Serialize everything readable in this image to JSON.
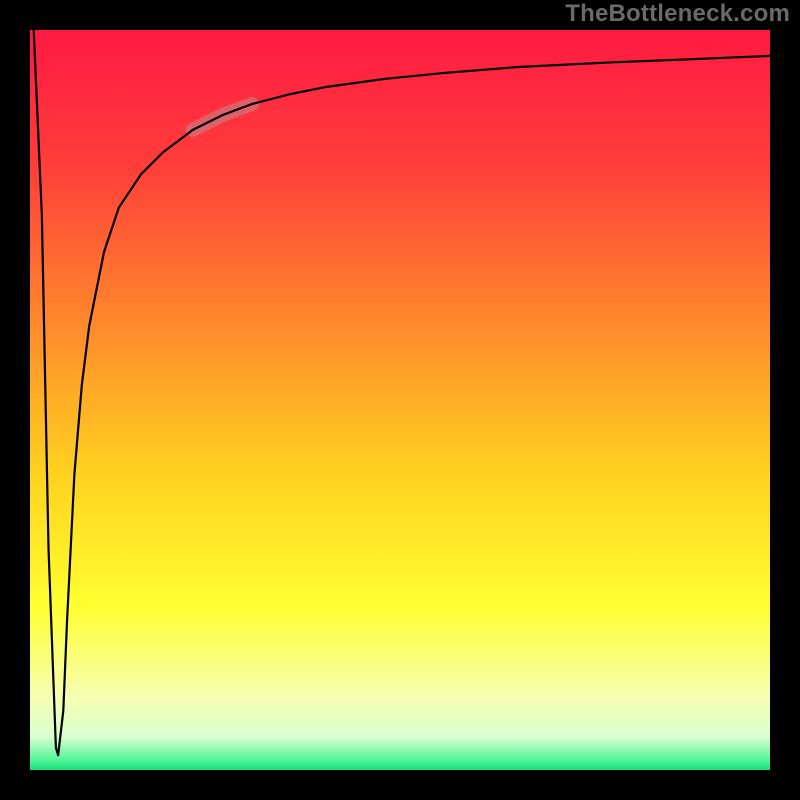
{
  "watermark": {
    "text": "TheBottleneck.com"
  },
  "colors": {
    "frame": "#000000",
    "curve": "#000000",
    "highlight": "#c3888a",
    "gradient_stops": [
      {
        "offset": 0.0,
        "color": "#ff1a42"
      },
      {
        "offset": 0.18,
        "color": "#ff3d3a"
      },
      {
        "offset": 0.4,
        "color": "#ff8a2b"
      },
      {
        "offset": 0.6,
        "color": "#ffd21f"
      },
      {
        "offset": 0.78,
        "color": "#ffff30"
      },
      {
        "offset": 0.9,
        "color": "#f6ffb0"
      },
      {
        "offset": 0.955,
        "color": "#d9ffd0"
      },
      {
        "offset": 0.985,
        "color": "#59f59a"
      },
      {
        "offset": 1.0,
        "color": "#16e07a"
      }
    ]
  },
  "chart_data": {
    "type": "line",
    "title": "",
    "xlabel": "",
    "ylabel": "",
    "xlim": [
      0,
      100
    ],
    "ylim": [
      0,
      100
    ],
    "series": [
      {
        "name": "bottleneck-curve",
        "x": [
          0.5,
          1.6,
          2.5,
          3.5,
          3.8,
          4.5,
          5,
          6,
          7,
          8,
          10,
          12,
          15,
          18,
          22,
          26,
          30,
          35,
          40,
          48,
          56,
          66,
          78,
          88,
          100
        ],
        "y": [
          100,
          75,
          30,
          3,
          2,
          8,
          20,
          40,
          52,
          60,
          70,
          76,
          80.5,
          83.5,
          86.5,
          88.5,
          90,
          91.3,
          92.3,
          93.4,
          94.2,
          95,
          95.6,
          96,
          96.5
        ]
      }
    ],
    "highlight_range": {
      "x_start": 22,
      "x_end": 30
    }
  },
  "layout": {
    "frame_inset": 30
  }
}
